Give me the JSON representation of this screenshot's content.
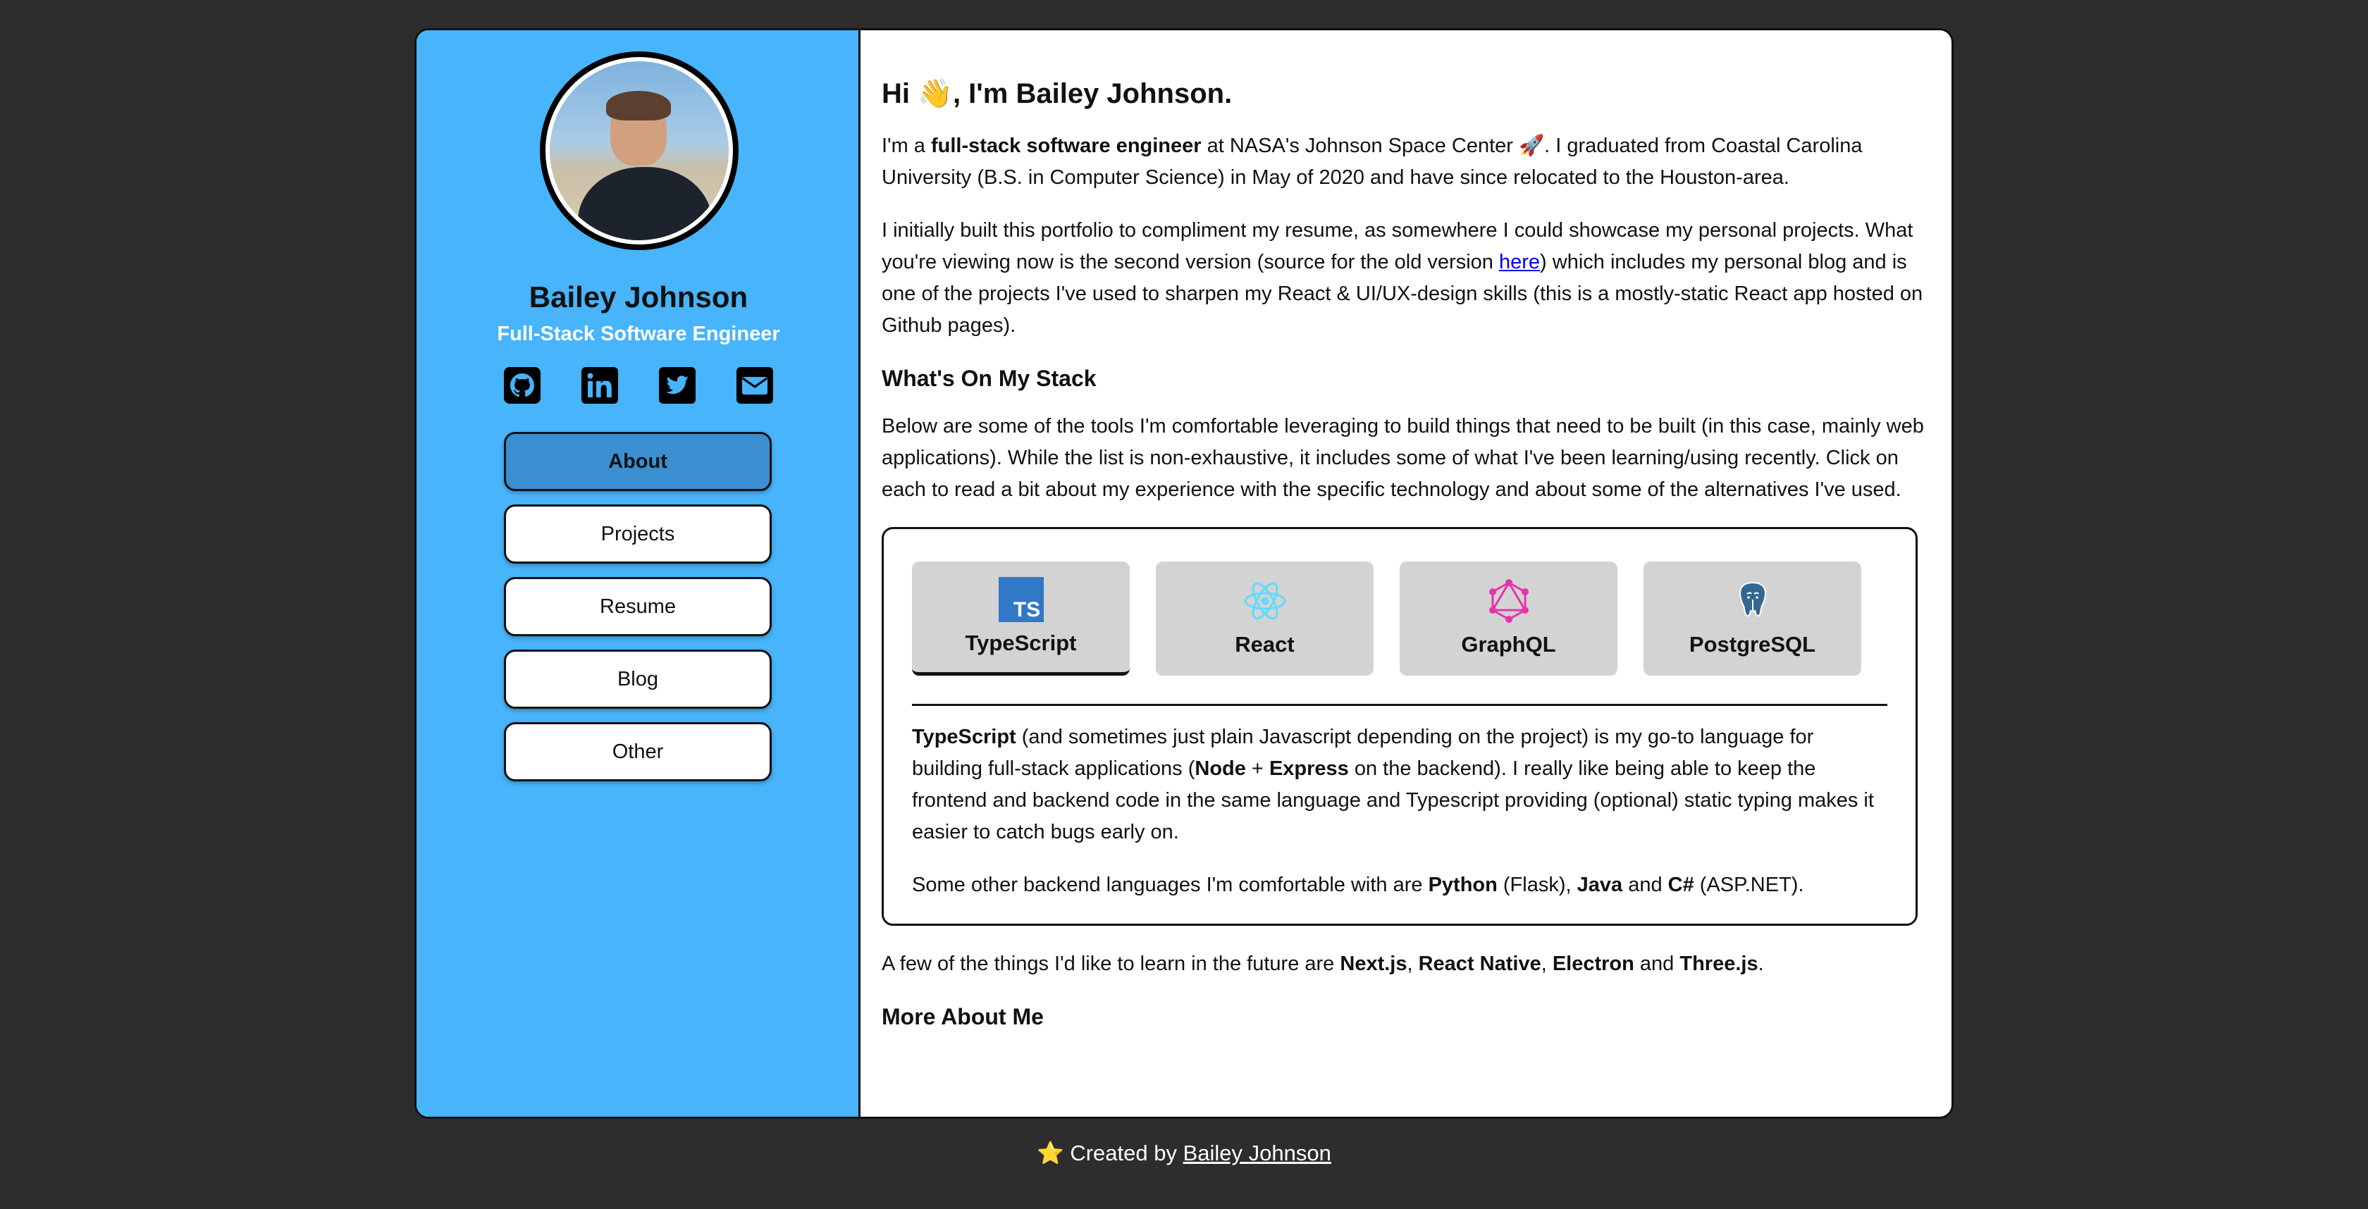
{
  "profile": {
    "name": "Bailey Johnson",
    "title": "Full-Stack Software Engineer",
    "social_icons": [
      "github-icon",
      "linkedin-icon",
      "twitter-icon",
      "mail-icon"
    ]
  },
  "nav": {
    "items": [
      {
        "label": "About",
        "active": true
      },
      {
        "label": "Projects",
        "active": false
      },
      {
        "label": "Resume",
        "active": false
      },
      {
        "label": "Blog",
        "active": false
      },
      {
        "label": "Other",
        "active": false
      }
    ]
  },
  "main": {
    "greeting_prefix": "Hi ",
    "wave_emoji": "👋",
    "greeting_suffix": ", I'm Bailey Johnson.",
    "intro": {
      "p1_a": "I'm a ",
      "p1_b": "full-stack software engineer",
      "p1_c": " at NASA's Johnson Space Center ",
      "rocket_emoji": "🚀",
      "p1_d": ". I graduated from Coastal Carolina University (B.S. in Computer Science) in May of 2020 and have since relocated to the Houston-area.",
      "p2_a": "I initially built this portfolio to compliment my resume, as somewhere I could showcase my personal projects. What you're viewing now is the second version (source for the old version ",
      "p2_link": "here",
      "p2_b": ") which includes my personal blog and is one of the projects I've used to sharpen my React & UI/UX-design skills (this is a mostly-static React app hosted on Github pages)."
    },
    "stack_heading": "What's On My Stack",
    "stack_intro": "Below are some of the tools I'm comfortable leveraging to build things that need to be built (in this case, mainly web applications). While the list is non-exhaustive, it includes some of what I've been learning/using recently. Click on each to read a bit about my experience with the specific technology and about some of the alternatives I've used.",
    "stack_tabs": [
      {
        "label": "TypeScript",
        "icon": "typescript-icon",
        "active": true
      },
      {
        "label": "React",
        "icon": "react-icon",
        "active": false
      },
      {
        "label": "GraphQL",
        "icon": "graphql-icon",
        "active": false
      },
      {
        "label": "PostgreSQL",
        "icon": "postgresql-icon",
        "active": false
      }
    ],
    "ts_icon_text": "TS",
    "stack_detail": {
      "d1_a": "TypeScript",
      "d1_b": " (and sometimes just plain Javascript depending on the project) is my go-to language for building full-stack applications (",
      "d1_c": "Node",
      "d1_d": " + ",
      "d1_e": "Express",
      "d1_f": " on the backend). I really like being able to keep the frontend and backend code in the same language and Typescript providing (optional) static typing makes it easier to catch bugs early on.",
      "d2_a": "Some other backend languages I'm comfortable with are ",
      "d2_b": "Python",
      "d2_c": " (Flask), ",
      "d2_d": "Java",
      "d2_e": " and ",
      "d2_f": "C#",
      "d2_g": " (ASP.NET)."
    },
    "future": {
      "a": "A few of the things I'd like to learn in the future are ",
      "b": "Next.js",
      "c": ", ",
      "d": "React Native",
      "e": ", ",
      "f": "Electron",
      "g": " and ",
      "h": "Three.js",
      "i": "."
    },
    "more_heading": "More About Me"
  },
  "footer": {
    "star": "⭐",
    "text": " Created by ",
    "link": "Bailey Johnson"
  },
  "colors": {
    "sidebar_bg": "#47b4fb",
    "active_nav": "#3a8fd0",
    "page_bg": "#2d2d2d",
    "tab_bg": "#d3d3d3",
    "typescript": "#3178c6",
    "react": "#61dafb",
    "graphql": "#e535ab",
    "postgresql": "#336791"
  }
}
